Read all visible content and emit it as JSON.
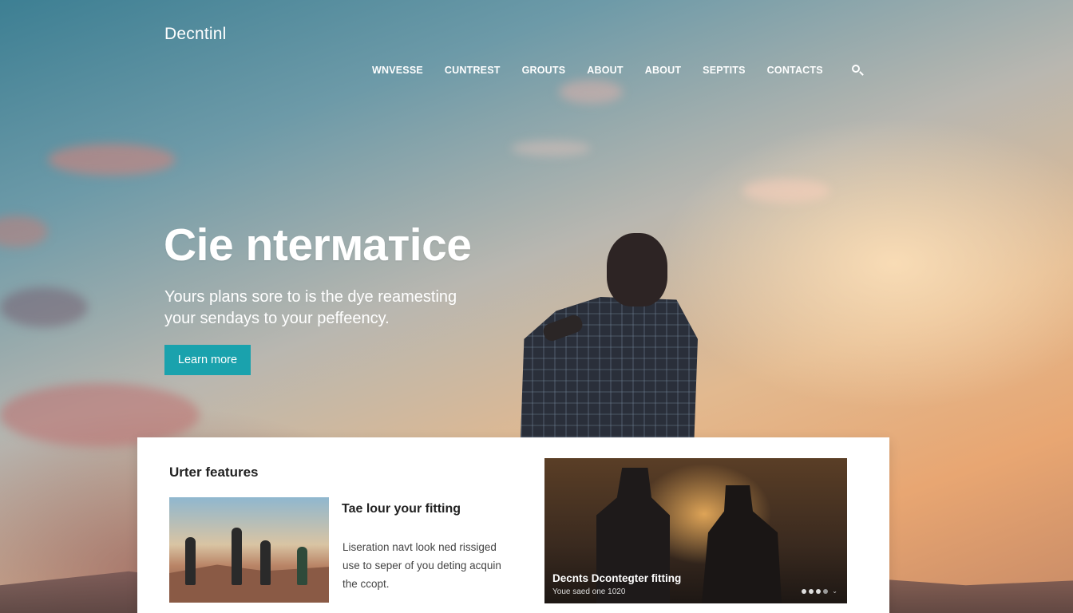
{
  "header": {
    "brand": "Decntinl",
    "nav": [
      "WNVESSE",
      "CUNTREST",
      "GROUTS",
      "ABOUT",
      "ABOUT",
      "SEPTITS",
      "CONTACTS"
    ],
    "search_icon": "search-icon"
  },
  "hero": {
    "title": "Cie nterматice",
    "subtitle_line1": "Yours plans sore to is the dye reamesting",
    "subtitle_line2": "your sendays to your peffeency.",
    "cta_label": "Learn more",
    "cta_color": "#1aa2ad"
  },
  "features": {
    "heading": "Urter features",
    "card": {
      "title": "Tae lour your fitting",
      "body": "Liseration navt look ned rissiged use to seper of you deting acquin the ccopt."
    },
    "featured": {
      "caption": "Decnts Dcontegter fitting",
      "subcaption": "Youe saed one 1020",
      "slides": 4,
      "active_slide": 1
    }
  }
}
